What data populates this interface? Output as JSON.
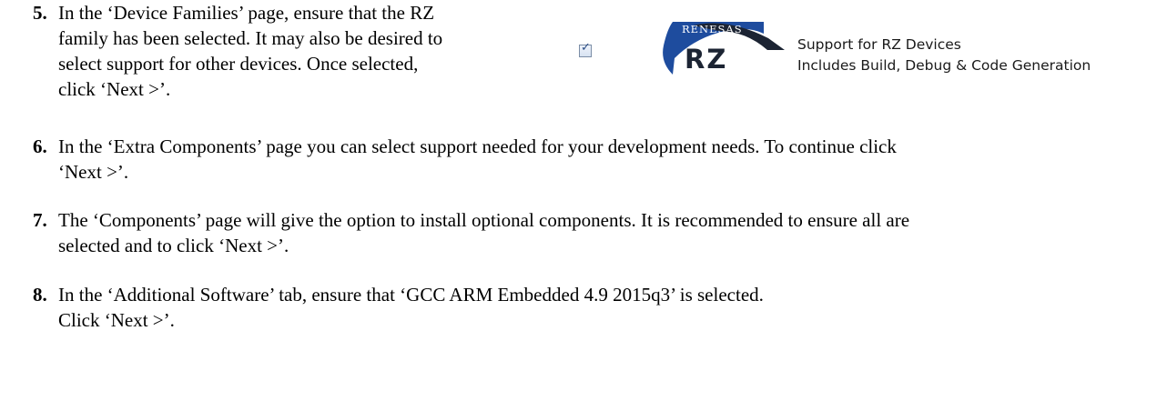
{
  "steps": [
    {
      "number": "5.",
      "lines": [
        "In the ‘Device Families’ page, ensure that the RZ",
        "family has been selected. It may also be desired to",
        "select support for other devices. Once selected,",
        "click ‘Next >’."
      ]
    },
    {
      "number": "6.",
      "lines": [
        "In the ‘Extra Components’ page you can select support needed for your development needs. To continue click",
        "‘Next >’."
      ]
    },
    {
      "number": "7.",
      "lines": [
        "The ‘Components’ page will give the option to install optional components. It is recommended to ensure all are",
        "selected and to click ‘Next >’."
      ]
    },
    {
      "number": "8.",
      "lines": [
        "In the ‘Additional Software’ tab, ensure that ‘GCC ARM Embedded 4.9 2015q3’ is selected.",
        "Click ‘Next >’."
      ]
    }
  ],
  "device_family": {
    "checked": true,
    "brand": "RENESAS",
    "family": "RZ",
    "support_line1": "Support for RZ Devices",
    "support_line2": "Includes Build, Debug & Code Generation",
    "colors": {
      "brand_blue": "#1e4c9e",
      "logo_dark": "#1c2433"
    }
  }
}
